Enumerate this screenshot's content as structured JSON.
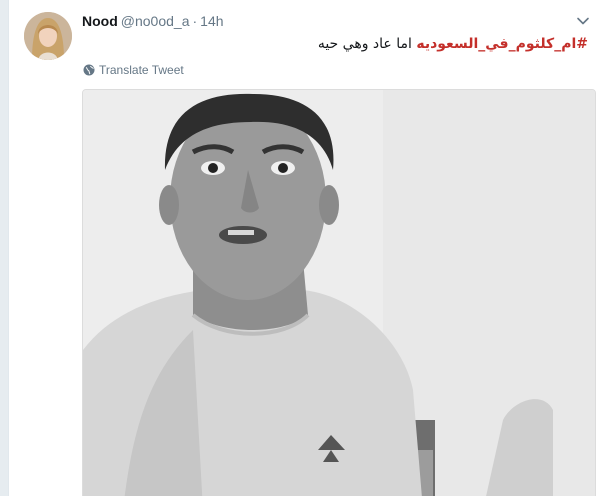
{
  "tweet": {
    "display_name": "Nood",
    "handle": "@no0od_a",
    "separator": "·",
    "time": "14h",
    "hashtag": "#ام_كلثوم_في_السعوديه",
    "text": "اما عاد وهي حيه",
    "translate_label": "Translate Tweet"
  },
  "icons": {
    "caret": "chevron-down-icon",
    "translate": "globe-icon"
  },
  "colors": {
    "hashtag": "#c4302b",
    "muted": "#657786",
    "background": "#e6ecf0"
  }
}
